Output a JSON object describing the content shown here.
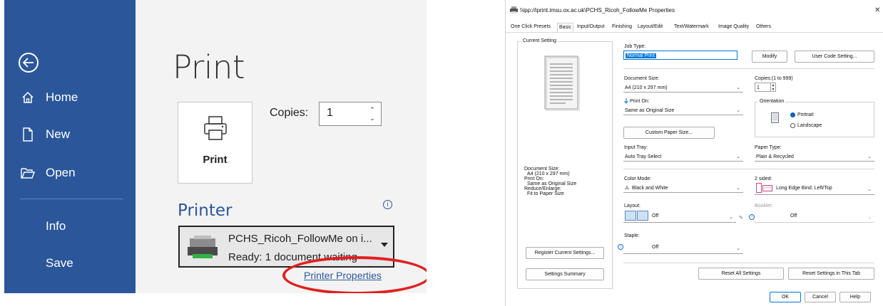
{
  "word": {
    "rail": {
      "home": "Home",
      "new": "New",
      "open": "Open",
      "info": "Info",
      "save": "Save"
    },
    "title": "Print",
    "print_button": "Print",
    "copies_label": "Copies:",
    "copies_value": "1",
    "printer_section": "Printer",
    "printer_name": "PCHS_Ricoh_FollowMe on i...",
    "printer_status": "Ready: 1 document waiting",
    "printer_properties_link": "Printer Properties",
    "accent_color": "#2b579a",
    "highlight_color": "#e02020"
  },
  "dialog": {
    "title": "\\\\ipp://iprint.imsu.ox.ac.uk\\PCHS_Ricoh_FollowMe Properties",
    "tabs": [
      "One Click Presets",
      "Basic",
      "Input/Output",
      "Finishing",
      "Layout/Edit",
      "Text/Watermark",
      "Image Quality",
      "Others"
    ],
    "current_setting_label": "Current Setting",
    "summary": {
      "doc_size_label": "Document Size:",
      "doc_size_value": "A4 (210 x 297 mm)",
      "print_on_label": "Print On:",
      "print_on_value": "Same as Original Size",
      "reduce_label": "Reduce/Enlarge:",
      "reduce_value": "Fit to Paper Size"
    },
    "register_button": "Register Current Settings...",
    "summary_button": "Settings Summary",
    "job_type_label": "Job Type:",
    "job_type_value": "Normal Print",
    "modify_button": "Modify",
    "user_code_button": "User Code Setting...",
    "document_size_label": "Document Size:",
    "document_size_value": "A4 (210 x 297 mm)",
    "copies_label": "Copies:(1 to 999)",
    "copies_value": "1",
    "print_on_label": "Print On:",
    "print_on_value": "Same as Original Size",
    "orientation_label": "Orientation",
    "portrait_label": "Portrait",
    "landscape_label": "Landscape",
    "custom_paper_button": "Custom Paper Size...",
    "input_tray_label": "Input Tray:",
    "input_tray_value": "Auto Tray Select",
    "paper_type_label": "Paper Type:",
    "paper_type_value": "Plain & Recycled",
    "color_mode_label": "Color Mode:",
    "color_mode_value": "Black and White",
    "two_sided_label": "2 sided:",
    "two_sided_value": "Long Edge Bind: Left/Top",
    "layout_label": "Layout:",
    "layout_value": "Off",
    "booklet_label": "Booklet:",
    "booklet_value": "Off",
    "staple_label": "Staple:",
    "staple_value": "Off",
    "reset_all_button": "Reset All Settings",
    "reset_tab_button": "Reset Settings in This Tab",
    "ok_button": "OK",
    "cancel_button": "Cancel",
    "help_button": "Help"
  }
}
